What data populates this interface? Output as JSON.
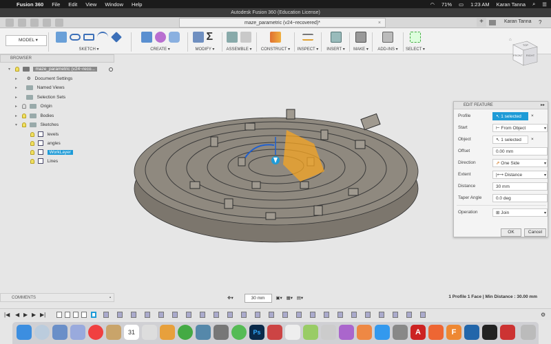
{
  "menubar": {
    "app": "Fusion 360",
    "items": [
      "File",
      "Edit",
      "View",
      "Window",
      "Help"
    ],
    "battery": "71%",
    "time": "1:23 AM",
    "user": "Karan Tanna"
  },
  "window_title": "Autodesk Fusion 360 (Education License)",
  "doc_tab": "maze_parametric (v24~recovered)*",
  "account_name": "Karan Tanna",
  "toolbar": {
    "workspace": "MODEL",
    "groups": [
      "SKETCH",
      "CREATE",
      "MODIFY",
      "ASSEMBLE",
      "CONSTRUCT",
      "INSPECT",
      "INSERT",
      "MAKE",
      "ADD-INS",
      "SELECT"
    ]
  },
  "browser": {
    "header": "BROWSER",
    "root": "maze_parametric (v24~reco...",
    "items": [
      "Document Settings",
      "Named Views",
      "Selection Sets",
      "Origin",
      "Bodies",
      "Sketches"
    ],
    "sketches": [
      "levels",
      "angles",
      "WorkLayer",
      "Lines"
    ]
  },
  "viewcube": {
    "faces": [
      "TOP",
      "FRONT",
      "RIGHT"
    ]
  },
  "edit_feature": {
    "title": "EDIT FEATURE",
    "rows": [
      {
        "label": "Profile",
        "value": "1 selected"
      },
      {
        "label": "Start",
        "value": "From Object"
      },
      {
        "label": "Object",
        "value": "1 selected"
      },
      {
        "label": "Offset",
        "value": "0.00 mm"
      },
      {
        "label": "Direction",
        "value": "One Side"
      },
      {
        "label": "Extent",
        "value": "Distance"
      },
      {
        "label": "Distance",
        "value": "30 mm"
      },
      {
        "label": "Taper Angle",
        "value": "0.0 deg"
      },
      {
        "label": "Operation",
        "value": "Join"
      }
    ],
    "ok": "OK",
    "cancel": "Cancel"
  },
  "comments": "COMMENTS",
  "nav": {
    "distance": "30 mm"
  },
  "status": "1 Profile 1 Face | Min Distance : 30.00 mm",
  "dock": {
    "calendar_day": "31"
  },
  "colors": {
    "accent": "#1e9bd7",
    "selection": "#f5a623",
    "model": "#8a8379"
  }
}
